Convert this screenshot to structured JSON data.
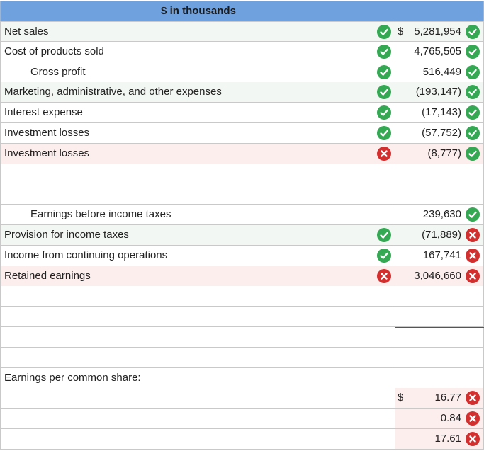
{
  "header": {
    "title": "$ in thousands"
  },
  "rows": [
    {
      "label": "Net sales",
      "indent": 0,
      "bg": "green",
      "left_icon": "check-icon",
      "dollar": "$",
      "value": "5,281,954",
      "right_icon": "check-icon"
    },
    {
      "label": "Cost of products sold",
      "indent": 0,
      "bg": "white",
      "left_icon": "check-icon",
      "dollar": "",
      "value": "4,765,505",
      "right_icon": "check-icon"
    },
    {
      "label": "Gross profit",
      "indent": 1,
      "bg": "white",
      "left_icon": "check-icon",
      "dollar": "",
      "value": "516,449",
      "right_icon": "check-icon"
    },
    {
      "label": "Marketing, administrative, and other expenses",
      "indent": 0,
      "bg": "green",
      "left_icon": "check-icon",
      "dollar": "",
      "value": "(193,147)",
      "right_icon": "check-icon"
    },
    {
      "label": "Interest expense",
      "indent": 0,
      "bg": "white",
      "left_icon": "check-icon",
      "dollar": "",
      "value": "(17,143)",
      "right_icon": "check-icon"
    },
    {
      "label": "Investment losses",
      "indent": 0,
      "bg": "white",
      "left_icon": "check-icon",
      "dollar": "",
      "value": "(57,752)",
      "right_icon": "check-icon"
    },
    {
      "label": "Investment losses",
      "indent": 0,
      "bg": "red",
      "left_icon": "x-icon",
      "dollar": "",
      "value": "(8,777)",
      "right_icon": "check-icon"
    },
    {
      "label": "",
      "indent": 0,
      "bg": "white",
      "left_icon": "",
      "dollar": "",
      "value": "",
      "right_icon": ""
    },
    {
      "label": "",
      "indent": 0,
      "bg": "white",
      "left_icon": "",
      "dollar": "",
      "value": "",
      "right_icon": ""
    },
    {
      "label": "Earnings before income taxes",
      "indent": 1,
      "bg": "white",
      "left_icon": "",
      "dollar": "",
      "value": "239,630",
      "right_icon": "check-icon"
    },
    {
      "label": "Provision for income taxes",
      "indent": 0,
      "bg": "green",
      "left_icon": "check-icon",
      "dollar": "",
      "value": "(71,889)",
      "right_icon": "x-icon"
    },
    {
      "label": "Income from continuing operations",
      "indent": 0,
      "bg": "white",
      "left_icon": "check-icon",
      "dollar": "",
      "value": "167,741",
      "right_icon": "x-icon"
    },
    {
      "label": "Retained earnings",
      "indent": 0,
      "bg": "red",
      "left_icon": "x-icon",
      "dollar": "",
      "value": "3,046,660",
      "right_icon": "x-icon"
    },
    {
      "label": "",
      "indent": 0,
      "bg": "white",
      "left_icon": "",
      "dollar": "",
      "value": "",
      "right_icon": ""
    },
    {
      "label": "",
      "indent": 0,
      "bg": "white",
      "left_icon": "",
      "dollar": "",
      "value": "",
      "right_icon": ""
    },
    {
      "label": "",
      "indent": 0,
      "bg": "white",
      "left_icon": "",
      "dollar": "",
      "value": "",
      "right_icon": ""
    },
    {
      "label": "",
      "indent": 0,
      "bg": "white",
      "left_icon": "",
      "dollar": "",
      "value": "",
      "right_icon": ""
    },
    {
      "label": "Earnings per common share:",
      "indent": 0,
      "bg": "white",
      "left_icon": "",
      "dollar": "",
      "value": "",
      "right_icon": ""
    },
    {
      "label": "",
      "indent": 0,
      "bg": "white",
      "left_icon": "",
      "dollar": "$",
      "value": "16.77",
      "right_icon": "x-icon"
    },
    {
      "label": "",
      "indent": 0,
      "bg": "white",
      "left_icon": "",
      "dollar": "",
      "value": "0.84",
      "right_icon": "x-icon"
    },
    {
      "label": "",
      "indent": 0,
      "bg": "white",
      "left_icon": "",
      "dollar": "",
      "value": "17.61",
      "right_icon": "x-icon"
    }
  ],
  "colors": {
    "header": "#6fa1df",
    "correct": "#34a853",
    "incorrect": "#d32f2f",
    "row_green": "#f3f7f3",
    "row_red": "#fdeeee"
  }
}
